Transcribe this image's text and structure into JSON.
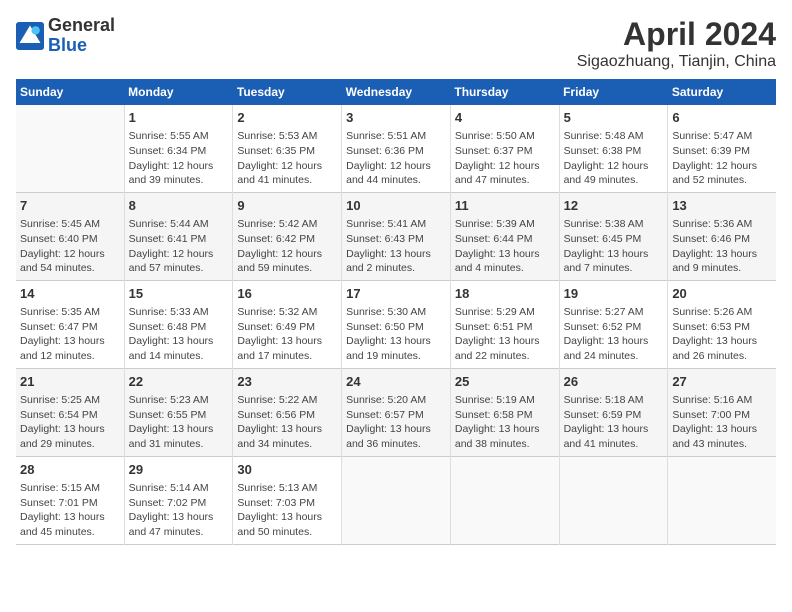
{
  "header": {
    "logo_line1": "General",
    "logo_line2": "Blue",
    "title": "April 2024",
    "subtitle": "Sigaozhuang, Tianjin, China"
  },
  "calendar": {
    "days_of_week": [
      "Sunday",
      "Monday",
      "Tuesday",
      "Wednesday",
      "Thursday",
      "Friday",
      "Saturday"
    ],
    "weeks": [
      [
        {
          "day": "",
          "info": ""
        },
        {
          "day": "1",
          "info": "Sunrise: 5:55 AM\nSunset: 6:34 PM\nDaylight: 12 hours\nand 39 minutes."
        },
        {
          "day": "2",
          "info": "Sunrise: 5:53 AM\nSunset: 6:35 PM\nDaylight: 12 hours\nand 41 minutes."
        },
        {
          "day": "3",
          "info": "Sunrise: 5:51 AM\nSunset: 6:36 PM\nDaylight: 12 hours\nand 44 minutes."
        },
        {
          "day": "4",
          "info": "Sunrise: 5:50 AM\nSunset: 6:37 PM\nDaylight: 12 hours\nand 47 minutes."
        },
        {
          "day": "5",
          "info": "Sunrise: 5:48 AM\nSunset: 6:38 PM\nDaylight: 12 hours\nand 49 minutes."
        },
        {
          "day": "6",
          "info": "Sunrise: 5:47 AM\nSunset: 6:39 PM\nDaylight: 12 hours\nand 52 minutes."
        }
      ],
      [
        {
          "day": "7",
          "info": "Sunrise: 5:45 AM\nSunset: 6:40 PM\nDaylight: 12 hours\nand 54 minutes."
        },
        {
          "day": "8",
          "info": "Sunrise: 5:44 AM\nSunset: 6:41 PM\nDaylight: 12 hours\nand 57 minutes."
        },
        {
          "day": "9",
          "info": "Sunrise: 5:42 AM\nSunset: 6:42 PM\nDaylight: 12 hours\nand 59 minutes."
        },
        {
          "day": "10",
          "info": "Sunrise: 5:41 AM\nSunset: 6:43 PM\nDaylight: 13 hours\nand 2 minutes."
        },
        {
          "day": "11",
          "info": "Sunrise: 5:39 AM\nSunset: 6:44 PM\nDaylight: 13 hours\nand 4 minutes."
        },
        {
          "day": "12",
          "info": "Sunrise: 5:38 AM\nSunset: 6:45 PM\nDaylight: 13 hours\nand 7 minutes."
        },
        {
          "day": "13",
          "info": "Sunrise: 5:36 AM\nSunset: 6:46 PM\nDaylight: 13 hours\nand 9 minutes."
        }
      ],
      [
        {
          "day": "14",
          "info": "Sunrise: 5:35 AM\nSunset: 6:47 PM\nDaylight: 13 hours\nand 12 minutes."
        },
        {
          "day": "15",
          "info": "Sunrise: 5:33 AM\nSunset: 6:48 PM\nDaylight: 13 hours\nand 14 minutes."
        },
        {
          "day": "16",
          "info": "Sunrise: 5:32 AM\nSunset: 6:49 PM\nDaylight: 13 hours\nand 17 minutes."
        },
        {
          "day": "17",
          "info": "Sunrise: 5:30 AM\nSunset: 6:50 PM\nDaylight: 13 hours\nand 19 minutes."
        },
        {
          "day": "18",
          "info": "Sunrise: 5:29 AM\nSunset: 6:51 PM\nDaylight: 13 hours\nand 22 minutes."
        },
        {
          "day": "19",
          "info": "Sunrise: 5:27 AM\nSunset: 6:52 PM\nDaylight: 13 hours\nand 24 minutes."
        },
        {
          "day": "20",
          "info": "Sunrise: 5:26 AM\nSunset: 6:53 PM\nDaylight: 13 hours\nand 26 minutes."
        }
      ],
      [
        {
          "day": "21",
          "info": "Sunrise: 5:25 AM\nSunset: 6:54 PM\nDaylight: 13 hours\nand 29 minutes."
        },
        {
          "day": "22",
          "info": "Sunrise: 5:23 AM\nSunset: 6:55 PM\nDaylight: 13 hours\nand 31 minutes."
        },
        {
          "day": "23",
          "info": "Sunrise: 5:22 AM\nSunset: 6:56 PM\nDaylight: 13 hours\nand 34 minutes."
        },
        {
          "day": "24",
          "info": "Sunrise: 5:20 AM\nSunset: 6:57 PM\nDaylight: 13 hours\nand 36 minutes."
        },
        {
          "day": "25",
          "info": "Sunrise: 5:19 AM\nSunset: 6:58 PM\nDaylight: 13 hours\nand 38 minutes."
        },
        {
          "day": "26",
          "info": "Sunrise: 5:18 AM\nSunset: 6:59 PM\nDaylight: 13 hours\nand 41 minutes."
        },
        {
          "day": "27",
          "info": "Sunrise: 5:16 AM\nSunset: 7:00 PM\nDaylight: 13 hours\nand 43 minutes."
        }
      ],
      [
        {
          "day": "28",
          "info": "Sunrise: 5:15 AM\nSunset: 7:01 PM\nDaylight: 13 hours\nand 45 minutes."
        },
        {
          "day": "29",
          "info": "Sunrise: 5:14 AM\nSunset: 7:02 PM\nDaylight: 13 hours\nand 47 minutes."
        },
        {
          "day": "30",
          "info": "Sunrise: 5:13 AM\nSunset: 7:03 PM\nDaylight: 13 hours\nand 50 minutes."
        },
        {
          "day": "",
          "info": ""
        },
        {
          "day": "",
          "info": ""
        },
        {
          "day": "",
          "info": ""
        },
        {
          "day": "",
          "info": ""
        }
      ]
    ]
  }
}
